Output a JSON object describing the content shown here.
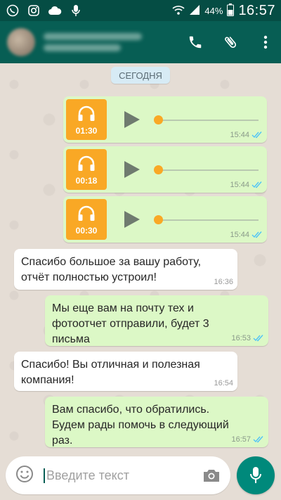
{
  "status_bar": {
    "battery": "44%",
    "time": "16:57",
    "left_icons": [
      "whatsapp-icon",
      "instagram-icon",
      "cloud-icon",
      "mic-notification-icon"
    ],
    "right_icons": [
      "wifi-icon",
      "signal-icon",
      "battery-icon"
    ]
  },
  "header": {
    "actions": [
      "call-icon",
      "attach-icon",
      "more-menu-icon"
    ]
  },
  "chat": {
    "date_label": "СЕГОДНЯ",
    "voice_messages": [
      {
        "duration": "01:30",
        "time": "15:44",
        "progress": 0
      },
      {
        "duration": "00:18",
        "time": "15:44",
        "progress": 0
      },
      {
        "duration": "00:30",
        "time": "15:44",
        "progress": 0
      }
    ],
    "messages": [
      {
        "direction": "in",
        "lines": [
          "Спасибо большое за вашу работу,",
          "отчёт полностью устроил!"
        ],
        "time": "16:36"
      },
      {
        "direction": "out",
        "lines": [
          "Мы еще вам на почту тех и",
          "фотоотчет отправили, будет 3",
          "письма"
        ],
        "time": "16:53"
      },
      {
        "direction": "in",
        "lines": [
          "Спасибо! Вы отличная и полезная",
          "компания!"
        ],
        "time": "16:54"
      },
      {
        "direction": "out",
        "lines": [
          "Вам спасибо, что обратились.",
          "Будем рады помочь в следующий",
          "раз."
        ],
        "time": "16:57"
      }
    ]
  },
  "composer": {
    "placeholder": "Введите текст"
  },
  "colors": {
    "header": "#075e54",
    "status_bar": "#054d44",
    "outgoing_bubble": "#dcf8c6",
    "incoming_bubble": "#ffffff",
    "voice_accent": "#f9a825",
    "read_ticks": "#4fc3f7",
    "fab": "#00897b"
  }
}
